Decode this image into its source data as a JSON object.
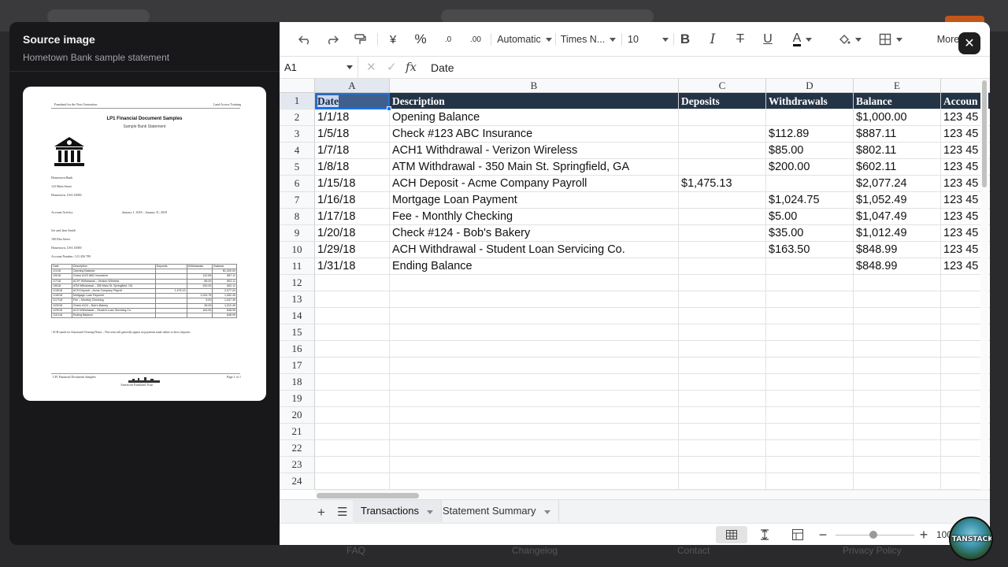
{
  "background": {
    "footer_items": [
      "FAQ",
      "Changelog",
      "Contact",
      "Privacy Policy"
    ]
  },
  "left_panel": {
    "title": "Source image",
    "subtitle": "Hometown Bank sample statement",
    "document": {
      "header_left": "Farmland for the Next Generation",
      "header_right": "Land Access Training",
      "title": "LP1 Financial Document Samples",
      "subtitle": "Sample Bank Statement",
      "bank_name": "Hometown Bank",
      "bank_address": "123 Main Street",
      "bank_city": "Hometown, USA 10000",
      "activity_label": "Account Activity",
      "activity_range": "January 1, 2018 – January 31, 2018",
      "holder_name": "Joe and Jane Smith",
      "holder_address": "100 Elm Street",
      "holder_city": "Hometown, USA 10000",
      "account_number": "Account Number: 123 456 789",
      "table_headers": [
        "Date",
        "Description",
        "Deposits",
        "Withdrawals",
        "Balance"
      ],
      "table_rows": [
        [
          "1/1/18",
          "Opening Balance",
          "",
          "",
          "$1,000.00"
        ],
        [
          "1/5/18",
          "Check #123 ABC Insurance",
          "",
          "112.89",
          "887.11"
        ],
        [
          "1/7/18",
          "ACH¹ Withdrawal – Verizon Wireless",
          "",
          "85.00",
          "802.11"
        ],
        [
          "1/8/18",
          "ATM Withdrawal – 350 Main St. Springfield, GA",
          "",
          "200.00",
          "602.11"
        ],
        [
          "1/15/18",
          "ACH Deposit – Acme Company Payroll",
          "1,475.13",
          "",
          "2,077.24"
        ],
        [
          "1/16/18",
          "Mortgage Loan Payment",
          "",
          "1,024.75",
          "1,052.49"
        ],
        [
          "1/17/18",
          "Fee – Monthly Checking",
          "",
          "5.00",
          "1,047.49"
        ],
        [
          "1/20/18",
          "Check #124 – Bob's Bakery",
          "",
          "35.00",
          "1,012.49"
        ],
        [
          "1/29/18",
          "ACH Withdrawal – Student Loan Servicing Co.",
          "",
          "163.50",
          "848.99"
        ],
        [
          "1/31/18",
          "Ending Balance",
          "",
          "",
          "848.99"
        ]
      ],
      "footnote": "¹ ACH stands for Automated Clearing House – This term will generally appear on payments made online or direct deposits",
      "footer_left": "LP1 Financial Document Samples",
      "footer_right": "Page 1 of 1",
      "footer_logo": "American Farmland Trust"
    }
  },
  "toolbar": {
    "undo_icon": "undo-icon",
    "redo_icon": "redo-icon",
    "paint_format_icon": "paint-format-icon",
    "currency_label": "¥",
    "percent_label": "%",
    "decrease_decimal_label": ".0",
    "increase_decimal_label": ".00",
    "number_format": "Automatic",
    "font_family": "Times N...",
    "font_size": "10",
    "bold_label": "B",
    "italic_label": "I",
    "strike_label": "T",
    "underline_label": "U",
    "text_color_label": "A",
    "more_label": "More",
    "close_label": "✕"
  },
  "formula_bar": {
    "cell_ref": "A1",
    "fx_label": "fx",
    "value": "Date"
  },
  "columns": [
    "A",
    "B",
    "C",
    "D",
    "E"
  ],
  "header_row": [
    "Date",
    "Description",
    "Deposits",
    "Withdrawals",
    "Balance",
    "Accoun"
  ],
  "rows": [
    [
      "1/1/18",
      "Opening Balance",
      "",
      "",
      "$1,000.00",
      "123 45"
    ],
    [
      "1/5/18",
      "Check #123 ABC Insurance",
      "",
      "$112.89",
      "$887.11",
      "123 45"
    ],
    [
      "1/7/18",
      "ACH1 Withdrawal - Verizon Wireless",
      "",
      "$85.00",
      "$802.11",
      "123 45"
    ],
    [
      "1/8/18",
      "ATM Withdrawal - 350 Main St. Springfield, GA",
      "",
      "$200.00",
      "$602.11",
      "123 45"
    ],
    [
      "1/15/18",
      "ACH Deposit - Acme Company Payroll",
      "$1,475.13",
      "",
      "$2,077.24",
      "123 45"
    ],
    [
      "1/16/18",
      "Mortgage Loan Payment",
      "",
      "$1,024.75",
      "$1,052.49",
      "123 45"
    ],
    [
      "1/17/18",
      "Fee - Monthly Checking",
      "",
      "$5.00",
      "$1,047.49",
      "123 45"
    ],
    [
      "1/20/18",
      "Check #124 - Bob's Bakery",
      "",
      "$35.00",
      "$1,012.49",
      "123 45"
    ],
    [
      "1/29/18",
      "ACH Withdrawal - Student Loan Servicing Co.",
      "",
      "$163.50",
      "$848.99",
      "123 45"
    ],
    [
      "1/31/18",
      "Ending Balance",
      "",
      "",
      "$848.99",
      "123 45"
    ]
  ],
  "row_numbers": [
    "1",
    "2",
    "3",
    "4",
    "5",
    "6",
    "7",
    "8",
    "9",
    "10",
    "11",
    "12",
    "13",
    "14",
    "15",
    "16",
    "17",
    "18",
    "19",
    "20",
    "21",
    "22",
    "23",
    "24"
  ],
  "sheet_tabs": [
    {
      "label": "Transactions",
      "active": true
    },
    {
      "label": "Statement Summary",
      "active": false
    }
  ],
  "status": {
    "zoom": "100"
  },
  "badge": {
    "text": "TANSTACK"
  },
  "colors": {
    "header_fill": "#243447",
    "selection": "#1a73e8",
    "modal_bg": "#18181b"
  }
}
